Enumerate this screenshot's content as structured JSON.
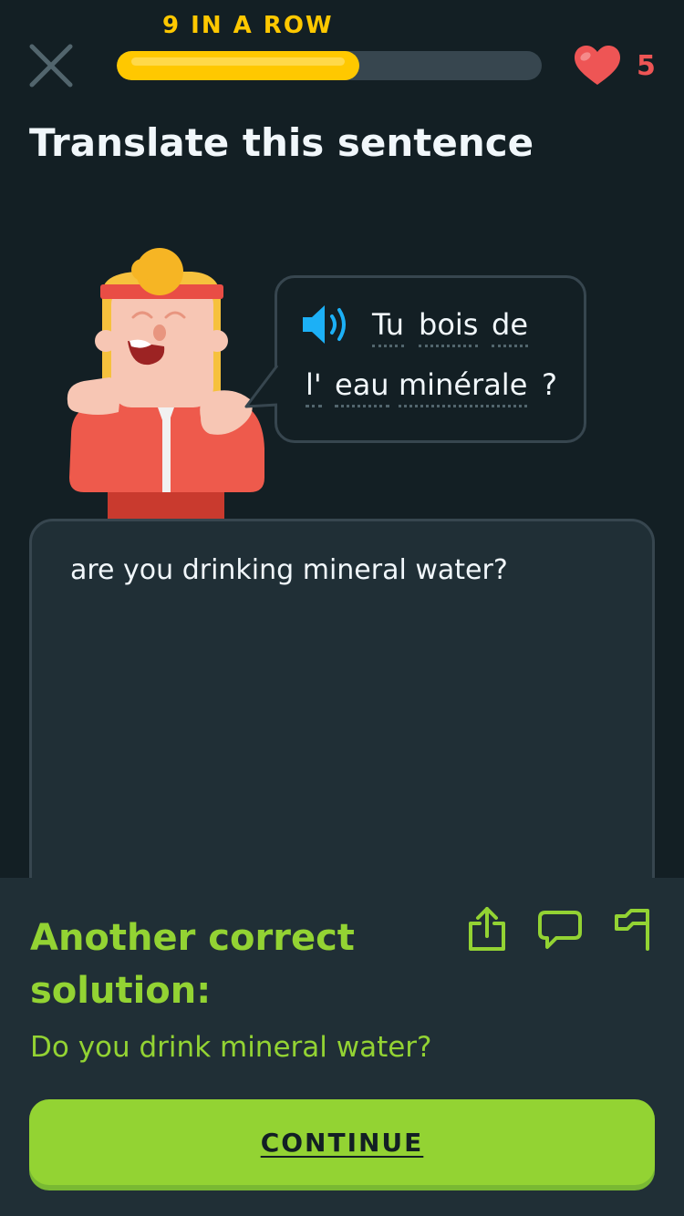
{
  "header": {
    "streak_label": "9 IN A ROW",
    "progress_fraction": 0.57,
    "hearts_count": "5"
  },
  "title": "Translate this sentence",
  "prompt": {
    "words": [
      "Tu",
      "bois",
      "de",
      "l'",
      "eau",
      "minérale",
      "?"
    ]
  },
  "answer": {
    "text": "are you drinking mineral water?"
  },
  "feedback": {
    "heading": "Another correct solution:",
    "solution": "Do you drink mineral water?",
    "icons": [
      "share-icon",
      "comment-icon",
      "flag-icon"
    ]
  },
  "continue_label": "CONTINUE",
  "colors": {
    "background": "#131f24",
    "streak": "#ffc800",
    "heart": "#ee5555",
    "correct_green": "#93d333",
    "speaker_blue": "#1cb0f6",
    "panel": "#202f36"
  }
}
